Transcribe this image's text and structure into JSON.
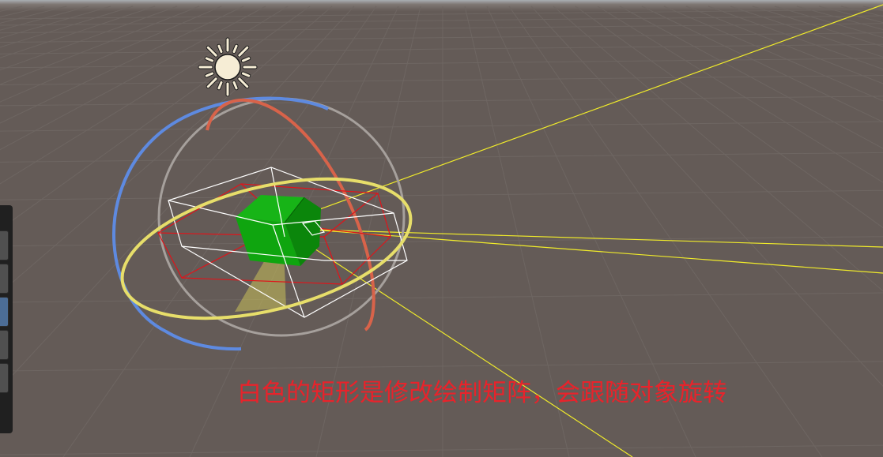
{
  "scene": {
    "annotation": "白色的矩形是修改绘制矩阵，会跟随对象旋转",
    "background_color": "#645b57",
    "grid_color": "#6e6662",
    "colors": {
      "directional_light_icon": "#f6edd5",
      "x_rotation_ring": "#d8634a",
      "y_rotation_ring": "#e7de6a",
      "z_rotation_ring": "#5e8ae0",
      "view_ring": "#a6a09c",
      "object_cube": "#0fa50f",
      "matrix_box": "#ffffff",
      "default_box": "#e0141a",
      "light_rays": "#f1ec2a",
      "light_cone": "#c8c05a",
      "annotation_text": "#e8232b"
    },
    "icons": [
      "sun-icon"
    ]
  },
  "tool_panel": {
    "buttons": [
      {
        "name": "tool-button-1",
        "active": false
      },
      {
        "name": "tool-button-2",
        "active": false
      },
      {
        "name": "tool-button-3",
        "active": true
      },
      {
        "name": "tool-button-4",
        "active": false
      },
      {
        "name": "tool-button-5",
        "active": false
      }
    ]
  }
}
